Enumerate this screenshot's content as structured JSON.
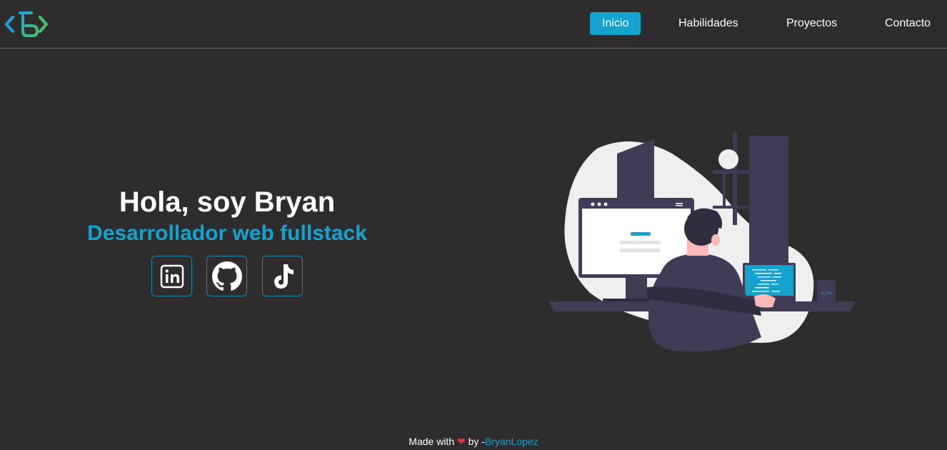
{
  "nav": {
    "items": [
      {
        "label": "Inicio",
        "active": true
      },
      {
        "label": "Habilidades",
        "active": false
      },
      {
        "label": "Proyectos",
        "active": false
      },
      {
        "label": "Contacto",
        "active": false
      }
    ]
  },
  "hero": {
    "title": "Hola, soy Bryan",
    "subtitle": "Desarrollador web fullstack"
  },
  "socials": [
    {
      "icon": "linkedin-icon"
    },
    {
      "icon": "github-icon"
    },
    {
      "icon": "tiktok-icon"
    }
  ],
  "footer": {
    "made_with": "Made with",
    "heart": "❤",
    "by": "by -",
    "author": "BryanLopez"
  },
  "colors": {
    "background": "#2e2c2d",
    "accent": "#14a3cf",
    "heart": "#e8333d"
  }
}
